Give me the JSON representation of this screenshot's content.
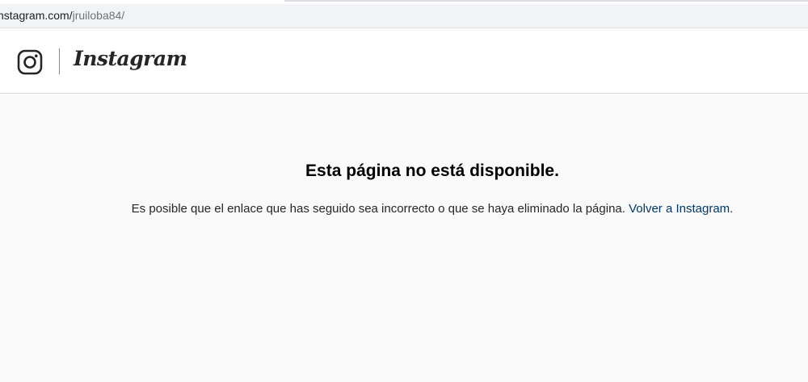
{
  "browser": {
    "url_host": "nstagram.com/",
    "url_path": "jruiloba84/"
  },
  "header": {
    "icon": "instagram-glyph-icon",
    "wordmark": "Instagram"
  },
  "error": {
    "title": "Esta página no está disponible.",
    "message": "Es posible que el enlace que has seguido sea incorrecto o que se haya eliminado la página.",
    "link_label": "Volver a Instagram."
  },
  "colors": {
    "link": "#00376b",
    "page_background": "#fafafa",
    "header_background": "#ffffff"
  }
}
